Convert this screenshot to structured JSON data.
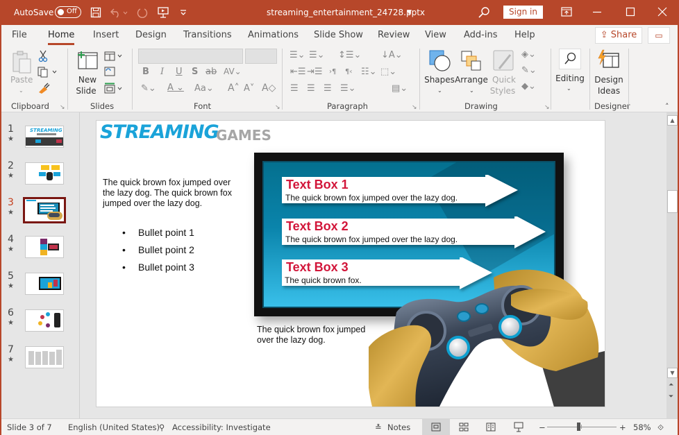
{
  "titlebar": {
    "autosave_label": "AutoSave",
    "autosave_state": "Off",
    "filename": "streaming_entertainment_24728.pptx",
    "sign_in": "Sign in"
  },
  "tabs": [
    "File",
    "Home",
    "Insert",
    "Design",
    "Transitions",
    "Animations",
    "Slide Show",
    "Review",
    "View",
    "Add-ins",
    "Help"
  ],
  "active_tab": "Home",
  "share_label": "Share",
  "ribbon": {
    "clipboard": {
      "label": "Clipboard",
      "paste": "Paste"
    },
    "slides": {
      "label": "Slides",
      "new_slide_1": "New",
      "new_slide_2": "Slide"
    },
    "font": {
      "label": "Font",
      "font_name": "",
      "font_size": ""
    },
    "paragraph": {
      "label": "Paragraph"
    },
    "drawing": {
      "label": "Drawing",
      "shapes": "Shapes",
      "arrange": "Arrange",
      "quick_styles_1": "Quick",
      "quick_styles_2": "Styles"
    },
    "editing": {
      "label": "Editing"
    },
    "designer": {
      "label": "Designer",
      "design_ideas_1": "Design",
      "design_ideas_2": "Ideas"
    }
  },
  "thumbnails": [
    {
      "num": "1",
      "selected": false
    },
    {
      "num": "2",
      "selected": false
    },
    {
      "num": "3",
      "selected": true
    },
    {
      "num": "4",
      "selected": false
    },
    {
      "num": "5",
      "selected": false
    },
    {
      "num": "6",
      "selected": false
    },
    {
      "num": "7",
      "selected": false
    }
  ],
  "slide": {
    "title_main": "STREAMING",
    "title_sub": "GAMES",
    "intro_text": [
      "The quick brown fox jumped over",
      "the lazy dog. The quick brown fox",
      "jumped over the lazy dog."
    ],
    "bullets": [
      "Bullet point 1",
      "Bullet point 2",
      "Bullet point 3"
    ],
    "caption": [
      "The quick brown fox jumped",
      "over the lazy dog."
    ],
    "text_boxes": [
      {
        "heading": "Text Box 1",
        "body": "The quick brown fox jumped over the lazy dog."
      },
      {
        "heading": "Text Box 2",
        "body": "The quick brown fox jumped over the lazy dog."
      },
      {
        "heading": "Text Box 3",
        "body": "The quick brown fox."
      }
    ],
    "colors": {
      "title_blue": "#1aa3d9",
      "heading_red": "#d2163a",
      "title_gray": "#a6a6a6"
    }
  },
  "status": {
    "slide_info": "Slide 3 of 7",
    "language": "English (United States)",
    "accessibility": "Accessibility: Investigate",
    "notes": "Notes",
    "zoom": "58%",
    "zoom_slider_value": 0.45
  },
  "accent_color": "#b7472a"
}
